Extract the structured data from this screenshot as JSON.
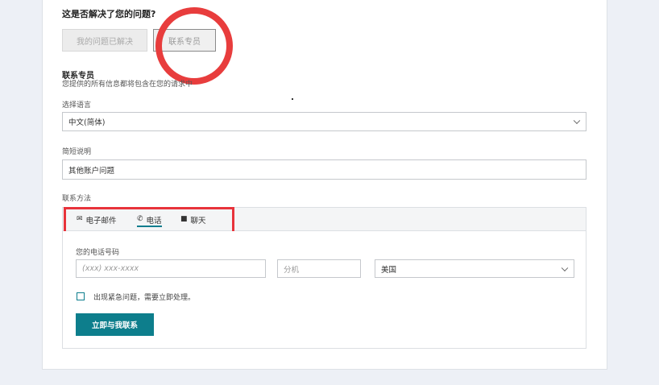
{
  "feedback": {
    "question": "这是否解决了您的问题?",
    "resolved_label": "我的问题已解决",
    "contact_label": "联系专员"
  },
  "contact": {
    "title": "联系专员",
    "subtitle": "您提供的所有信息都将包含在您的请求中"
  },
  "form": {
    "language_label": "选择语言",
    "language_value": "中文(简体)",
    "summary_label": "简短说明",
    "summary_value": "其他账户问题",
    "method_label": "联系方法"
  },
  "tabs": [
    {
      "label": "电子邮件",
      "icon": "envelope-icon"
    },
    {
      "label": "电话",
      "icon": "phone-icon"
    },
    {
      "label": "聊天",
      "icon": "chat-icon"
    }
  ],
  "active_tab": "电话",
  "phone": {
    "label": "您的电话号码",
    "number_placeholder": "(xxx) xxx-xxxx",
    "ext_placeholder": "分机",
    "country_value": "美国",
    "urgent_label": "出现紧急问题，需要立即处理。",
    "urgent_checked": false,
    "call_button": "立即与我联系"
  },
  "colors": {
    "accent": "#0d7e8c",
    "annotation": "#e83d3d",
    "background": "#edf0f6"
  }
}
